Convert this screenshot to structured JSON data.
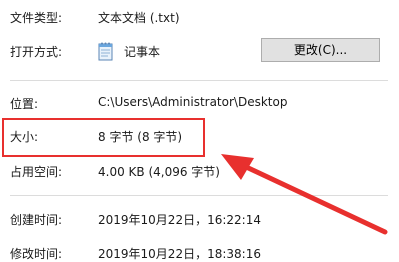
{
  "properties": {
    "file_type": {
      "label": "文件类型:",
      "value": "文本文档 (.txt)"
    },
    "opens_with": {
      "label": "打开方式:",
      "app_name": "记事本",
      "app_icon": "notepad-icon",
      "change_button": "更改(C)..."
    },
    "location": {
      "label": "位置:",
      "value": "C:\\Users\\Administrator\\Desktop"
    },
    "size": {
      "label": "大小:",
      "value": "8 字节 (8 字节)"
    },
    "size_on_disk": {
      "label": "占用空间:",
      "value": "4.00 KB (4,096 字节)"
    },
    "created": {
      "label": "创建时间:",
      "value": "2019年10月22日，16:22:14"
    },
    "modified": {
      "label": "修改时间:",
      "value": "2019年10月22日，18:38:16"
    }
  },
  "annotation": {
    "color": "#e8302e"
  }
}
